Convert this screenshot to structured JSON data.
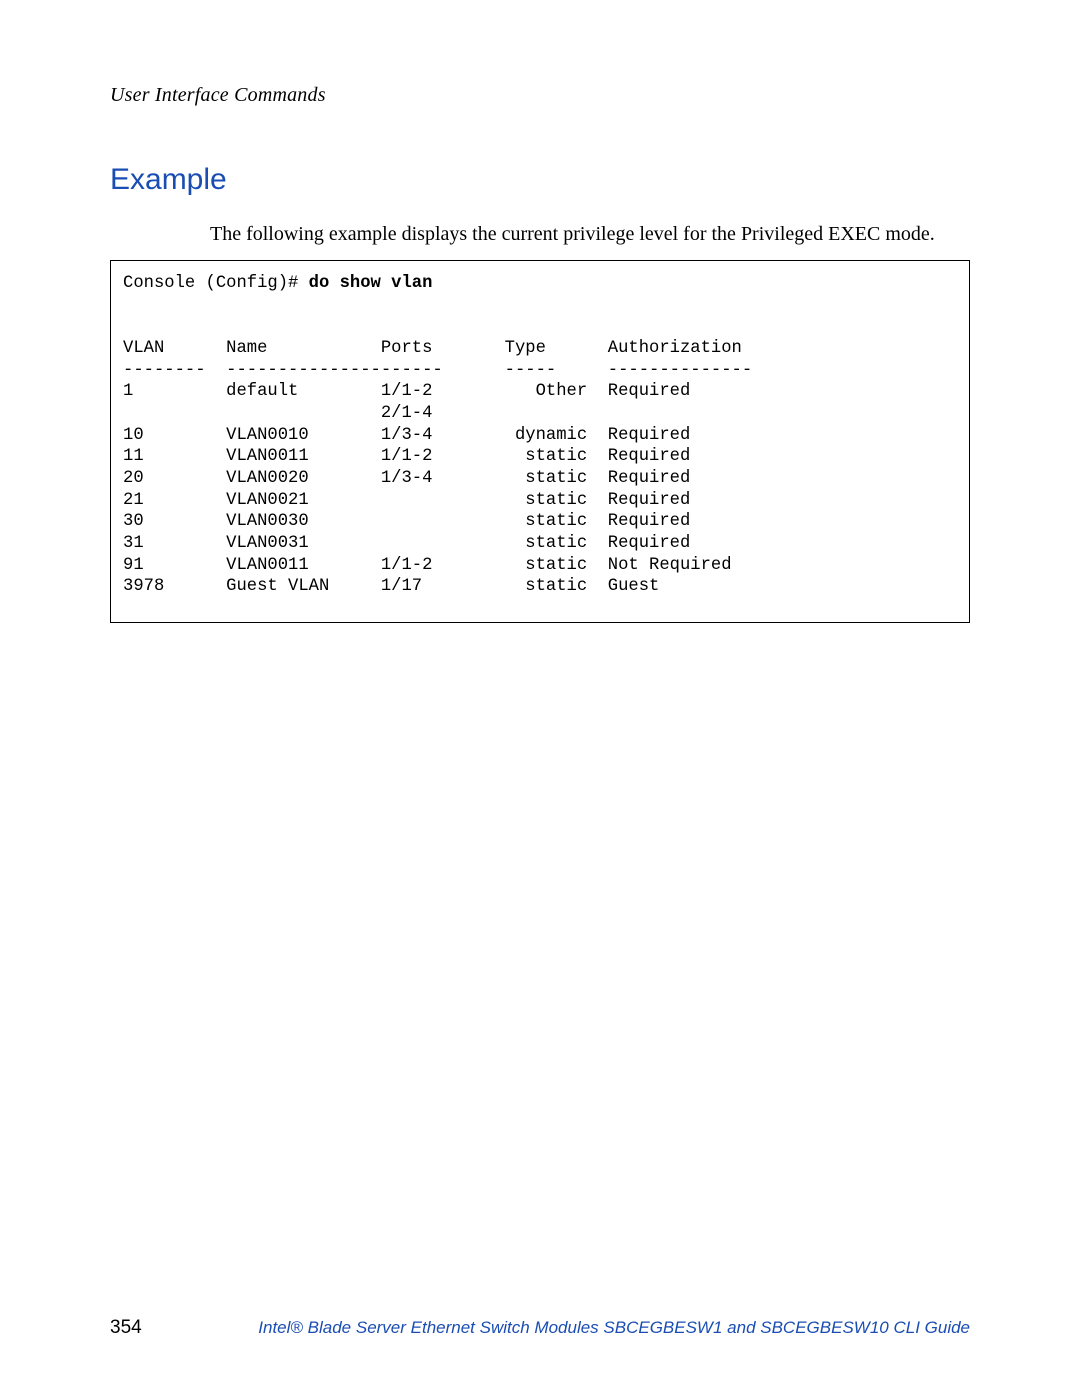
{
  "header": {
    "section_title": "User Interface Commands"
  },
  "content": {
    "heading": "Example",
    "intro": "The following example displays the current privilege level for the Privileged EXEC mode.",
    "console": {
      "prompt": "Console (Config)# ",
      "command": "do show vlan",
      "columns": {
        "vlan": "VLAN",
        "name": "Name",
        "ports": "Ports",
        "type": "Type",
        "auth": "Authorization"
      },
      "dashes": {
        "vlan": "--------",
        "name": "---------------",
        "ports": "------",
        "type": "-----",
        "auth": "--------------"
      },
      "rows": [
        {
          "vlan": "1",
          "name": "default",
          "ports": "1/1-2",
          "type": "Other",
          "auth": "Required"
        },
        {
          "vlan": "",
          "name": "",
          "ports": "2/1-4",
          "type": "",
          "auth": ""
        },
        {
          "vlan": "10",
          "name": "VLAN0010",
          "ports": "1/3-4",
          "type": "dynamic",
          "auth": "Required"
        },
        {
          "vlan": "11",
          "name": "VLAN0011",
          "ports": "1/1-2",
          "type": "static",
          "auth": "Required"
        },
        {
          "vlan": "20",
          "name": "VLAN0020",
          "ports": "1/3-4",
          "type": "static",
          "auth": "Required"
        },
        {
          "vlan": "21",
          "name": "VLAN0021",
          "ports": "",
          "type": "static",
          "auth": "Required"
        },
        {
          "vlan": "30",
          "name": "VLAN0030",
          "ports": "",
          "type": "static",
          "auth": "Required"
        },
        {
          "vlan": "31",
          "name": "VLAN0031",
          "ports": "",
          "type": "static",
          "auth": "Required"
        },
        {
          "vlan": "91",
          "name": "VLAN0011",
          "ports": "1/1-2",
          "type": "static",
          "auth": "Not Required"
        },
        {
          "vlan": "3978",
          "name": "Guest VLAN",
          "ports": "1/17",
          "type": "static",
          "auth": "Guest"
        }
      ]
    }
  },
  "footer": {
    "page_number": "354",
    "doc_title": "Intel® Blade Server Ethernet Switch Modules SBCEGBESW1 and SBCEGBESW10 CLI Guide"
  },
  "chart_data": {
    "type": "table",
    "title": "do show vlan output",
    "columns": [
      "VLAN",
      "Name",
      "Ports",
      "Type",
      "Authorization"
    ],
    "rows": [
      [
        "1",
        "default",
        "1/1-2 2/1-4",
        "Other",
        "Required"
      ],
      [
        "10",
        "VLAN0010",
        "1/3-4",
        "dynamic",
        "Required"
      ],
      [
        "11",
        "VLAN0011",
        "1/1-2",
        "static",
        "Required"
      ],
      [
        "20",
        "VLAN0020",
        "1/3-4",
        "static",
        "Required"
      ],
      [
        "21",
        "VLAN0021",
        "",
        "static",
        "Required"
      ],
      [
        "30",
        "VLAN0030",
        "",
        "static",
        "Required"
      ],
      [
        "31",
        "VLAN0031",
        "",
        "static",
        "Required"
      ],
      [
        "91",
        "VLAN0011",
        "1/1-2",
        "static",
        "Not Required"
      ],
      [
        "3978",
        "Guest VLAN",
        "1/17",
        "static",
        "Guest"
      ]
    ]
  }
}
